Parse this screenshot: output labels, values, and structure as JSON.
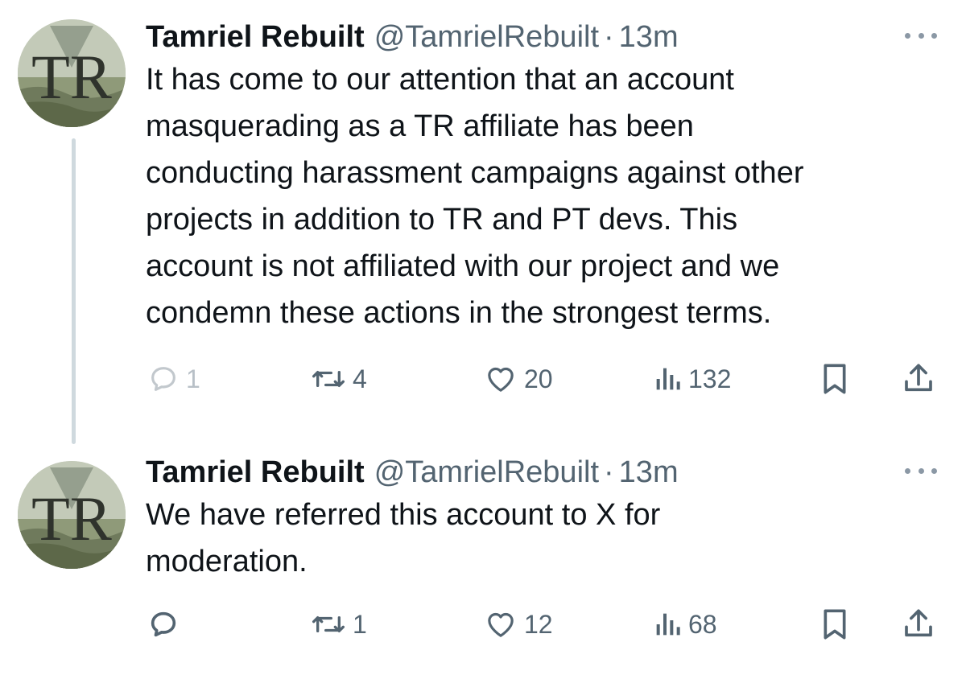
{
  "tweets": [
    {
      "author": {
        "display_name": "Tamriel Rebuilt",
        "handle": "@TamrielRebuilt",
        "avatar_monogram": "TR"
      },
      "separator": "·",
      "time": "13m",
      "text": "It has come to our attention that an account\nmasquerading as a TR affiliate has been\nconducting harassment campaigns against other\nprojects in addition to TR and PT devs. This\naccount is not affiliated with our project and we\ncondemn these actions in the strongest terms.",
      "actions": {
        "reply_count": "1",
        "retweet_count": "4",
        "like_count": "20",
        "view_count": "132"
      },
      "icons": [
        "reply-icon",
        "retweet-icon",
        "like-icon",
        "views-icon",
        "bookmark-icon",
        "share-icon",
        "more-icon"
      ]
    },
    {
      "author": {
        "display_name": "Tamriel Rebuilt",
        "handle": "@TamrielRebuilt",
        "avatar_monogram": "TR"
      },
      "separator": "·",
      "time": "13m",
      "text": "We have referred this account to X for\nmoderation.",
      "actions": {
        "reply_count": "",
        "retweet_count": "1",
        "like_count": "12",
        "view_count": "68"
      },
      "icons": [
        "reply-icon",
        "retweet-icon",
        "like-icon",
        "views-icon",
        "bookmark-icon",
        "share-icon",
        "more-icon"
      ]
    }
  ],
  "colors": {
    "text_primary": "#0f1419",
    "text_secondary": "#536471",
    "thread_line": "#cfd9de",
    "avatar_bg": "#b9c2a9"
  }
}
